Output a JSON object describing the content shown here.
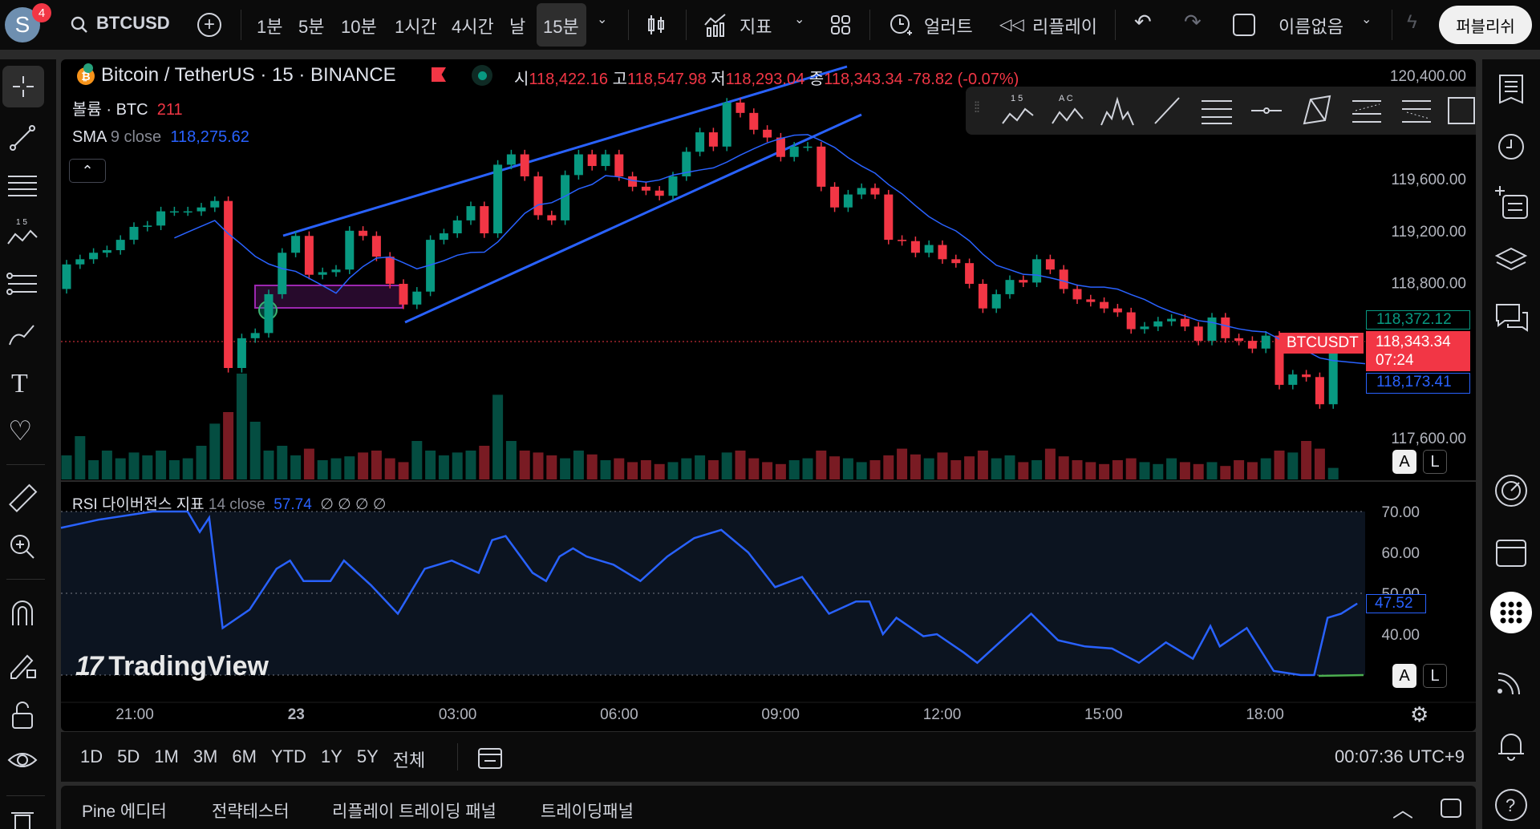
{
  "topbar": {
    "avatar_letter": "S",
    "notification_count": "4",
    "symbol": "BTCUSD",
    "intervals": [
      "1분",
      "5분",
      "10분",
      "1시간",
      "4시간",
      "날",
      "15분"
    ],
    "indicators_label": "지표",
    "alert_label": "얼러트",
    "replay_label": "리플레이",
    "layout_name": "이름없음",
    "publish_label": "퍼블리쉬"
  },
  "legend": {
    "title": "Bitcoin / TetherUS · 15 · BINANCE",
    "o_label": "시",
    "o": "118,422.16",
    "h_label": "고",
    "h": "118,547.98",
    "l_label": "저",
    "l": "118,293.04",
    "c_label": "종",
    "c": "118,343.34",
    "change": "-78.82 (-0.07%)",
    "volume_label": "볼륨 · BTC",
    "volume_value": "211",
    "sma_label": "SMA",
    "sma_params": "9 close",
    "sma_value": "118,275.62"
  },
  "rsi_legend": {
    "label": "RSI 다이버전스 지표",
    "params": "14 close",
    "value": "57.74",
    "extras": "∅ ∅ ∅ ∅"
  },
  "watermark": "TradingView",
  "price_axis": {
    "ticks": [
      "120,400.00",
      "119,600.00",
      "119,200.00",
      "118,800.00",
      "117,600.00"
    ],
    "tick_values": [
      120400,
      119600,
      119200,
      118800,
      117600
    ],
    "high_tag": "118,372.12",
    "last_price": "118,343.34",
    "countdown": "07:24",
    "symbol_tag": "BTCUSDT",
    "sma_tag": "118,173.41"
  },
  "rsi_axis": {
    "ticks": [
      "70.00",
      "60.00",
      "50.00",
      "40.00"
    ],
    "tick_values": [
      70,
      60,
      50,
      40
    ],
    "current": "47.52"
  },
  "time_axis": [
    "21:00",
    "23",
    "03:00",
    "06:00",
    "09:00",
    "12:00",
    "15:00",
    "18:00"
  ],
  "scale_buttons": {
    "auto": "A",
    "log": "L"
  },
  "range_buttons": [
    "1D",
    "5D",
    "1M",
    "3M",
    "6M",
    "YTD",
    "1Y",
    "5Y",
    "전체"
  ],
  "clock": "00:07:36 UTC+9",
  "bottom_tabs": [
    "Pine 에디터",
    "전략테스터",
    "리플레이 트레이딩 패널",
    "트레이딩패널"
  ],
  "colors": {
    "up": "#089981",
    "down": "#f23645",
    "sma": "#2962ff",
    "rsi": "#2962ff",
    "accent": "#2962ff"
  },
  "chart_data": {
    "type": "candlestick",
    "interval": "15",
    "first_open": 118750,
    "closes": [
      118940,
      118980,
      119030,
      119050,
      119130,
      119230,
      119240,
      119350,
      119350,
      119350,
      119380,
      119430,
      118140,
      118370,
      118410,
      118710,
      119030,
      119160,
      118860,
      118880,
      118900,
      119200,
      119160,
      119000,
      118790,
      118630,
      118730,
      119130,
      119180,
      119280,
      119390,
      119180,
      119710,
      119790,
      119620,
      119320,
      119280,
      119630,
      119790,
      119700,
      119790,
      119620,
      119540,
      119510,
      119470,
      119620,
      119810,
      119960,
      119850,
      120190,
      120110,
      119980,
      119920,
      119770,
      119850,
      119850,
      119540,
      119380,
      119480,
      119530,
      119480,
      119130,
      119120,
      119030,
      119090,
      118980,
      118950,
      118790,
      118600,
      118710,
      118820,
      118800,
      118980,
      118900,
      118750,
      118670,
      118650,
      118600,
      118570,
      118440,
      118460,
      118500,
      118520,
      118460,
      118350,
      118530,
      118370,
      118350,
      118290,
      118390,
      118010,
      118090,
      118070,
      117860,
      118343
    ],
    "volumes": [
      25,
      45,
      20,
      30,
      22,
      28,
      25,
      30,
      20,
      22,
      35,
      58,
      70,
      110,
      60,
      30,
      35,
      25,
      32,
      20,
      22,
      24,
      28,
      30,
      22,
      18,
      40,
      30,
      25,
      28,
      30,
      35,
      88,
      40,
      30,
      28,
      25,
      22,
      30,
      26,
      20,
      22,
      18,
      20,
      16,
      18,
      22,
      25,
      20,
      28,
      30,
      22,
      18,
      16,
      20,
      22,
      30,
      24,
      22,
      18,
      20,
      25,
      32,
      26,
      22,
      28,
      20,
      24,
      30,
      22,
      25,
      18,
      20,
      32,
      24,
      20,
      18,
      16,
      20,
      22,
      18,
      16,
      22,
      18,
      16,
      18,
      14,
      20,
      18,
      22,
      30,
      28,
      40,
      32,
      12
    ],
    "rsi": [
      [
        0,
        66
      ],
      [
        2.8,
        68
      ],
      [
        6.8,
        70
      ],
      [
        9.4,
        70
      ],
      [
        10.3,
        65
      ],
      [
        11,
        68.5
      ],
      [
        12,
        41.5
      ],
      [
        14,
        46
      ],
      [
        16,
        56
      ],
      [
        17,
        58
      ],
      [
        18,
        53
      ],
      [
        20,
        53
      ],
      [
        21,
        58
      ],
      [
        23,
        52
      ],
      [
        25,
        45
      ],
      [
        27,
        56
      ],
      [
        29,
        58
      ],
      [
        31,
        55
      ],
      [
        32,
        63
      ],
      [
        33,
        64
      ],
      [
        35,
        55
      ],
      [
        36,
        53
      ],
      [
        37,
        59
      ],
      [
        38,
        61
      ],
      [
        39,
        59
      ],
      [
        41,
        57
      ],
      [
        43,
        53
      ],
      [
        45,
        59
      ],
      [
        47,
        63.5
      ],
      [
        49,
        65.5
      ],
      [
        51,
        60
      ],
      [
        53,
        51.5
      ],
      [
        55,
        54
      ],
      [
        57,
        45
      ],
      [
        59,
        48
      ],
      [
        60,
        48
      ],
      [
        61,
        40
      ],
      [
        62,
        44
      ],
      [
        64,
        39.5
      ],
      [
        65,
        40
      ],
      [
        67,
        35.5
      ],
      [
        68,
        33
      ],
      [
        70,
        39
      ],
      [
        72,
        45
      ],
      [
        74,
        38.5
      ],
      [
        76,
        37
      ],
      [
        78,
        36.5
      ],
      [
        80,
        33
      ],
      [
        82,
        38
      ],
      [
        84,
        34
      ],
      [
        85.3,
        42
      ],
      [
        86,
        37
      ],
      [
        88,
        41.5
      ],
      [
        90,
        31
      ],
      [
        92,
        30
      ],
      [
        93,
        30
      ],
      [
        94,
        44
      ],
      [
        95,
        45
      ],
      [
        96.2,
        47.5
      ]
    ],
    "ylim": [
      117500,
      120500
    ],
    "rsi_ylim": [
      30,
      70
    ]
  }
}
